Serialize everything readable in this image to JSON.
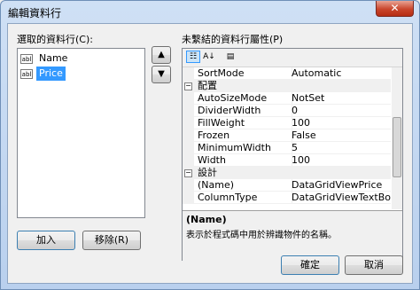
{
  "window": {
    "title": "編輯資料行",
    "close_glyph": "✕"
  },
  "selected_columns": {
    "label": "選取的資料行(C):",
    "items": [
      {
        "icon": "abl",
        "name": "Name",
        "selected": false
      },
      {
        "icon": "abl",
        "name": "Price",
        "selected": true
      }
    ]
  },
  "move_up_glyph": "▲",
  "move_down_glyph": "▼",
  "add_button": "加入",
  "remove_button": "移除(R)",
  "properties": {
    "label": "未繫結的資料行屬性(P)",
    "toolbar": {
      "categorized": "☷",
      "alphabetical": "A↓",
      "pages": "▤"
    },
    "rows": [
      {
        "type": "prop",
        "name": "SortMode",
        "value": "Automatic"
      },
      {
        "type": "cat",
        "expander": "−",
        "name": "配置"
      },
      {
        "type": "prop",
        "name": "AutoSizeMode",
        "value": "NotSet"
      },
      {
        "type": "prop",
        "name": "DividerWidth",
        "value": "0"
      },
      {
        "type": "prop",
        "name": "FillWeight",
        "value": "100"
      },
      {
        "type": "prop",
        "name": "Frozen",
        "value": "False"
      },
      {
        "type": "prop",
        "name": "MinimumWidth",
        "value": "5"
      },
      {
        "type": "prop",
        "name": "Width",
        "value": "100"
      },
      {
        "type": "cat",
        "expander": "−",
        "name": "設計"
      },
      {
        "type": "prop",
        "name": "(Name)",
        "value": "DataGridViewPrice"
      },
      {
        "type": "prop",
        "name": "ColumnType",
        "value": "DataGridViewTextBoxColu"
      }
    ],
    "help_title": "(Name)",
    "help_description": "表示於程式碼中用於辨識物件的名稱。"
  },
  "ok_button": "確定",
  "cancel_button": "取消"
}
